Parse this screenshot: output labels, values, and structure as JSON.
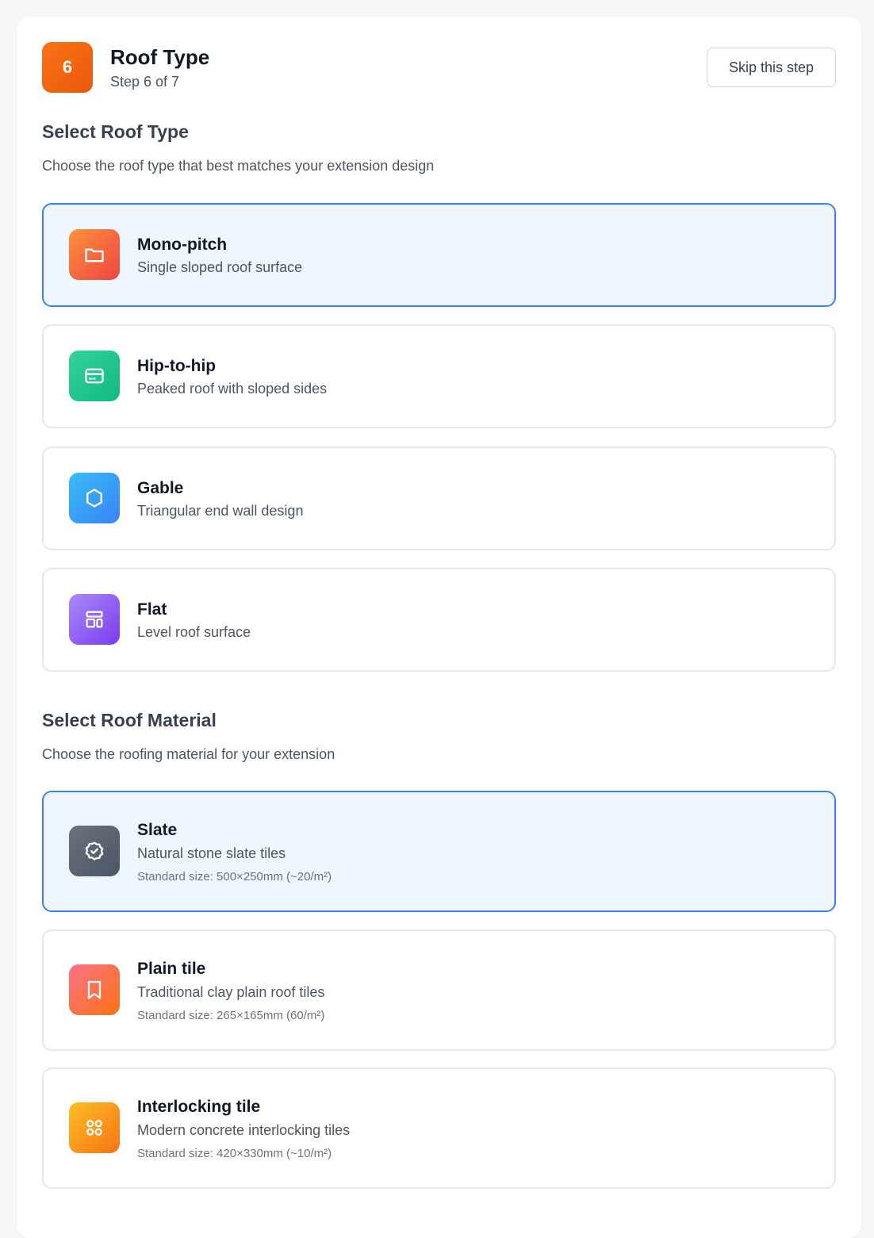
{
  "header": {
    "step_number": "6",
    "title": "Roof Type",
    "subtitle": "Step 6 of 7",
    "skip_label": "Skip this step"
  },
  "roof_type_section": {
    "title": "Select Roof Type",
    "description": "Choose the roof type that best matches your extension design",
    "options": [
      {
        "name": "Mono-pitch",
        "description": "Single sloped roof surface",
        "icon": "folder-icon",
        "selected": true
      },
      {
        "name": "Hip-to-hip",
        "description": "Peaked roof with sloped sides",
        "icon": "card-icon",
        "selected": false
      },
      {
        "name": "Gable",
        "description": "Triangular end wall design",
        "icon": "hexagon-icon",
        "selected": false
      },
      {
        "name": "Flat",
        "description": "Level roof surface",
        "icon": "layout-icon",
        "selected": false
      }
    ]
  },
  "roof_material_section": {
    "title": "Select Roof Material",
    "description": "Choose the roofing material for your extension",
    "options": [
      {
        "name": "Slate",
        "description": "Natural stone slate tiles",
        "size": "Standard size: 500×250mm (~20/m²)",
        "icon": "badge-check-icon",
        "selected": true
      },
      {
        "name": "Plain tile",
        "description": "Traditional clay plain roof tiles",
        "size": "Standard size: 265×165mm (60/m²)",
        "icon": "bookmark-icon",
        "selected": false
      },
      {
        "name": "Interlocking tile",
        "description": "Modern concrete interlocking tiles",
        "size": "Standard size: 420×330mm (~10/m²)",
        "icon": "grid-icon",
        "selected": false
      }
    ]
  },
  "colors": {
    "accent_orange": "#f97316",
    "selected_border": "#3b82f6",
    "selected_bg": "#eff6ff"
  }
}
